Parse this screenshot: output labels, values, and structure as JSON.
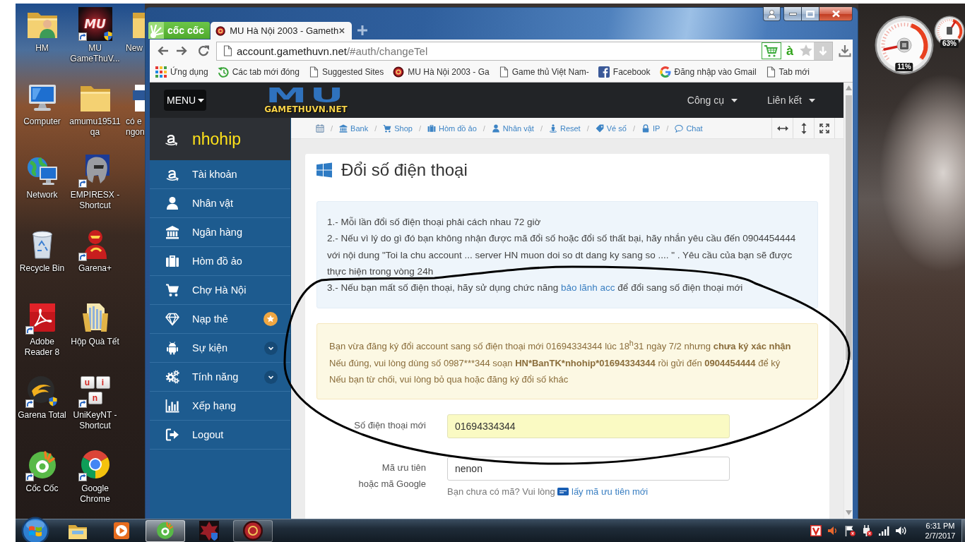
{
  "desktop": {
    "icons": [
      {
        "label": "HM",
        "shortcut": false
      },
      {
        "label": "Computer",
        "shortcut": false
      },
      {
        "label": "Network",
        "shortcut": false
      },
      {
        "label": "Recycle Bin",
        "shortcut": false
      },
      {
        "label": "Adobe Reader 8",
        "shortcut": true
      },
      {
        "label": "Garena Total",
        "shortcut": true
      },
      {
        "label": "Cốc Cốc",
        "shortcut": true
      },
      {
        "label": "MU GameThuV...",
        "shortcut": true,
        "logo_text": "MU"
      },
      {
        "label": "amumu19511qa",
        "shortcut": false
      },
      {
        "label": "EMPIRESX - Shortcut",
        "shortcut": true
      },
      {
        "label": "Garena+",
        "shortcut": true
      },
      {
        "label": "Hộp Quà Tết",
        "shortcut": false
      },
      {
        "label": "UniKeyNT - Shortcut",
        "shortcut": true,
        "key_letters": [
          "u",
          "i",
          "n"
        ]
      },
      {
        "label": "Google Chrome",
        "shortcut": true
      },
      {
        "label": "New",
        "shortcut": false
      },
      {
        "label": "có e ngon",
        "shortcut": false
      }
    ],
    "gadgets": [
      {
        "reading": "11%"
      },
      {
        "reading": "63%"
      }
    ]
  },
  "browser": {
    "brand": "cốc cốc",
    "tabs": [
      {
        "title": "MU Hà Nội 2003 - Gameth",
        "selected": true
      }
    ],
    "address": {
      "host": "account.gamethuvn.net",
      "path": "/#auth/changeTel"
    },
    "input_method": "à",
    "bookmarks": [
      {
        "label": "Ứng dụng"
      },
      {
        "label": "Các tab mới đóng"
      },
      {
        "label": "Suggested Sites"
      },
      {
        "label": "MU Hà Nội 2003 - Ga"
      },
      {
        "label": "Game thủ Việt Nam-"
      },
      {
        "label": "Facebook"
      },
      {
        "label": "Đăng nhập vào Gmail"
      },
      {
        "label": "Tab mới"
      }
    ]
  },
  "site": {
    "navbar": {
      "menu": "MENU",
      "logo_mark": "MU",
      "logo_text": "GAMETHUVN.NET",
      "links": [
        {
          "label": "Công cụ"
        },
        {
          "label": "Liên kết"
        }
      ]
    },
    "sidebar": {
      "username": "nhohip",
      "items": [
        {
          "label": "Tài khoản",
          "kind": "plain"
        },
        {
          "label": "Nhân vật",
          "kind": "plain"
        },
        {
          "label": "Ngân hàng",
          "kind": "plain"
        },
        {
          "label": "Hòm đồ ảo",
          "kind": "plain"
        },
        {
          "label": "Chợ Hà Nội",
          "kind": "plain"
        },
        {
          "label": "Nạp thẻ",
          "kind": "badge"
        },
        {
          "label": "Sự kiện",
          "kind": "dropdown"
        },
        {
          "label": "Tính năng",
          "kind": "dropdown"
        },
        {
          "label": "Xếp hạng",
          "kind": "plain"
        },
        {
          "label": "Logout",
          "kind": "plain"
        }
      ]
    },
    "breadcrumb": {
      "separator": "/",
      "items": [
        {
          "label": "Bank"
        },
        {
          "label": "Shop"
        },
        {
          "label": "Hòm đồ ảo"
        },
        {
          "label": "Nhân vật"
        },
        {
          "label": "Reset"
        },
        {
          "label": "Vé số"
        },
        {
          "label": "IP"
        },
        {
          "label": "Chat"
        }
      ]
    },
    "card": {
      "title": "Đổi số điện thoại",
      "notes": [
        {
          "text": "1.- Mỗi lần đổi số điện thoại phải cách nhau 72 giờ"
        },
        {
          "text": "2.- Nếu vì lý do gì đó bạn không nhận được mã đổi số hoặc đổi số thất bại, hãy nhắn yêu cầu đến 0904454444 với nội dung \"Toi la chu account ... server HN muon doi so dt dang ky sang so .... \" . Yêu cầu của bạn sẽ được thực hiện trong vòng 24h"
        },
        {
          "text": "3.- Nếu bạn mất số điện thoại, hãy sử dụng chức năng",
          "link": "bảo lãnh acc",
          "text_after": "để đổi sang số điện thoại mới"
        }
      ],
      "warning": [
        "Bạn vừa đăng ký đổi account sang số điện thoại mới 01694334344 lúc 18$^{h}$31 ngày 7/2 nhưng **chưa ký xác nhận**",
        [
          {
            "text": "Nếu đúng, vui lòng dùng số 0987***344 soạn",
            "bold": false
          },
          {
            "text": "HN*BanTK*nhohip*01694334344",
            "bold": true
          },
          {
            "text": "rồi gửi đến",
            "bold": false
          },
          {
            "text": "0904454444",
            "bold": true
          },
          {
            "text": "để ký",
            "bold": false
          }
        ],
        "Nếu bạn từ chối, vui lòng bỏ qua hoặc đăng ký đổi số khác"
      ],
      "fields": [
        {
          "label": "Số điện thoại mới",
          "value": "01694334344",
          "autofilled": true
        },
        {
          "label": "Mã ưu tiên\nhoặc mã Google",
          "value": "nenon",
          "autofilled": false
        }
      ],
      "help": {
        "text": "Bạn chưa có mã? Vui lòng",
        "link": "lấy mã ưu tiên mới"
      }
    }
  },
  "taskbar": {
    "apps": [
      {
        "running": false,
        "selected": false
      },
      {
        "running": false,
        "selected": false
      },
      {
        "running": true,
        "selected": true
      },
      {
        "running": false,
        "selected": false
      },
      {
        "running": true,
        "selected": false
      }
    ],
    "clock": {
      "time": "6:31 PM",
      "date": "2/7/2017"
    }
  }
}
